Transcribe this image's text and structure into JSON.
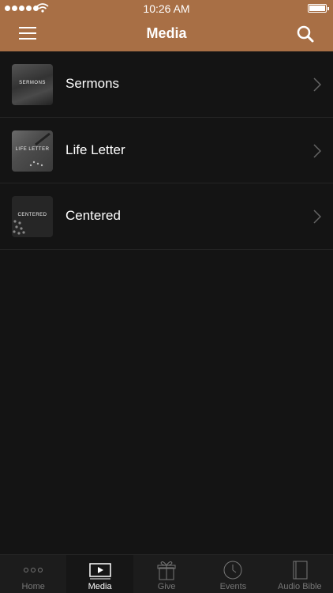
{
  "status_bar": {
    "time": "10:26 AM"
  },
  "header": {
    "title": "Media"
  },
  "media_items": [
    {
      "label": "Sermons",
      "thumb_text": "SERMONS"
    },
    {
      "label": "Life Letter",
      "thumb_text": "LIFE LETTER"
    },
    {
      "label": "Centered",
      "thumb_text": "CENTERED"
    }
  ],
  "tabs": [
    {
      "label": "Home",
      "icon": "more-dots-icon",
      "active": false
    },
    {
      "label": "Media",
      "icon": "play-icon",
      "active": true
    },
    {
      "label": "Give",
      "icon": "gift-icon",
      "active": false
    },
    {
      "label": "Events",
      "icon": "clock-icon",
      "active": false
    },
    {
      "label": "Audio Bible",
      "icon": "book-icon",
      "active": false
    }
  ],
  "colors": {
    "header": "#a86f45",
    "background": "#141414",
    "tabbar": "#1c1c1c"
  }
}
